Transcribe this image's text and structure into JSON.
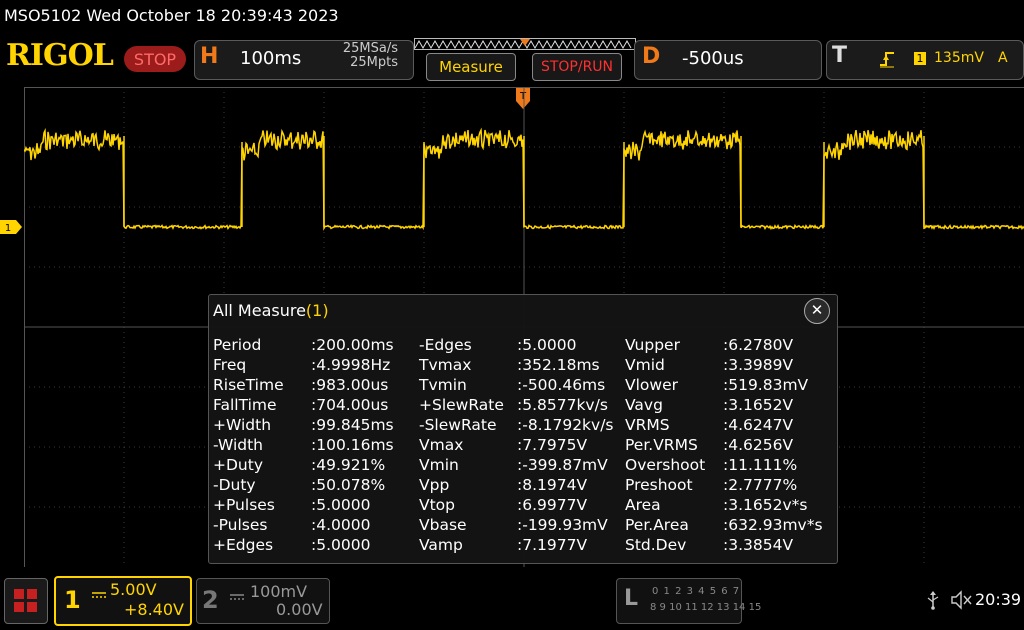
{
  "status_line": "MSO5102  Wed October 18 20:39:43 2023",
  "logo": "RIGOL",
  "run_state": "STOP",
  "horizontal": {
    "letter": "H",
    "timebase": "100ms",
    "sample_rate": "25MSa/s",
    "memory_depth": "25Mpts"
  },
  "buttons": {
    "measure": "Measure",
    "stop_run": "STOP/RUN"
  },
  "delay": {
    "letter": "D",
    "value": "-500us"
  },
  "trigger": {
    "letter": "T",
    "edge": "rising-edge-icon",
    "channel": "1",
    "level": "135mV",
    "mode": "A"
  },
  "ch1_marker": "1",
  "colors": {
    "ch1": "#ffd400",
    "stop": "#ff3030",
    "accent": "#f07a1a"
  },
  "measure_panel": {
    "title": "All Measure",
    "count": "(1)",
    "rows": [
      [
        {
          "k": "Period",
          "v": ":200.00ms"
        },
        {
          "k": "-Edges",
          "v": ":5.0000"
        },
        {
          "k": "Vupper",
          "v": ":6.2780V"
        }
      ],
      [
        {
          "k": "Freq",
          "v": ":4.9998Hz"
        },
        {
          "k": "Tvmax",
          "v": ":352.18ms"
        },
        {
          "k": "Vmid",
          "v": ":3.3989V"
        }
      ],
      [
        {
          "k": "RiseTime",
          "v": ":983.00us"
        },
        {
          "k": "Tvmin",
          "v": ":-500.46ms"
        },
        {
          "k": "Vlower",
          "v": ":519.83mV"
        }
      ],
      [
        {
          "k": "FallTime",
          "v": ":704.00us"
        },
        {
          "k": "+SlewRate",
          "v": ":5.8577kv/s"
        },
        {
          "k": "Vavg",
          "v": ":3.1652V"
        }
      ],
      [
        {
          "k": "+Width",
          "v": ":99.845ms"
        },
        {
          "k": "-SlewRate",
          "v": ":-8.1792kv/s"
        },
        {
          "k": "VRMS",
          "v": ":4.6247V"
        }
      ],
      [
        {
          "k": "-Width",
          "v": ":100.16ms"
        },
        {
          "k": "Vmax",
          "v": ":7.7975V"
        },
        {
          "k": "Per.VRMS",
          "v": ":4.6256V"
        }
      ],
      [
        {
          "k": "+Duty",
          "v": ":49.921%"
        },
        {
          "k": "Vmin",
          "v": ":-399.87mV"
        },
        {
          "k": "Overshoot",
          "v": ":11.111%"
        }
      ],
      [
        {
          "k": "-Duty",
          "v": ":50.078%"
        },
        {
          "k": "Vpp",
          "v": ":8.1974V"
        },
        {
          "k": "Preshoot",
          "v": ":2.7777%"
        }
      ],
      [
        {
          "k": "+Pulses",
          "v": ":5.0000"
        },
        {
          "k": "Vtop",
          "v": ":6.9977V"
        },
        {
          "k": "Area",
          "v": ":3.1652v*s"
        }
      ],
      [
        {
          "k": "-Pulses",
          "v": ":4.0000"
        },
        {
          "k": "Vbase",
          "v": ":-199.93mV"
        },
        {
          "k": "Per.Area",
          "v": ":632.93mv*s"
        }
      ],
      [
        {
          "k": "+Edges",
          "v": ":5.0000"
        },
        {
          "k": "Vamp",
          "v": ":7.1977V"
        },
        {
          "k": "Std.Dev",
          "v": ":3.3854V"
        }
      ]
    ]
  },
  "channel1": {
    "number": "1",
    "scale": "5.00V",
    "offset": "+8.40V"
  },
  "channel2": {
    "number": "2",
    "scale": "100mV",
    "offset": "0.00V"
  },
  "logic": {
    "letter": "L",
    "row1": "0 1 2 3  4 5 6 7",
    "row2": "8 9 10 11 12 13 14 15"
  },
  "clock": "20:39"
}
